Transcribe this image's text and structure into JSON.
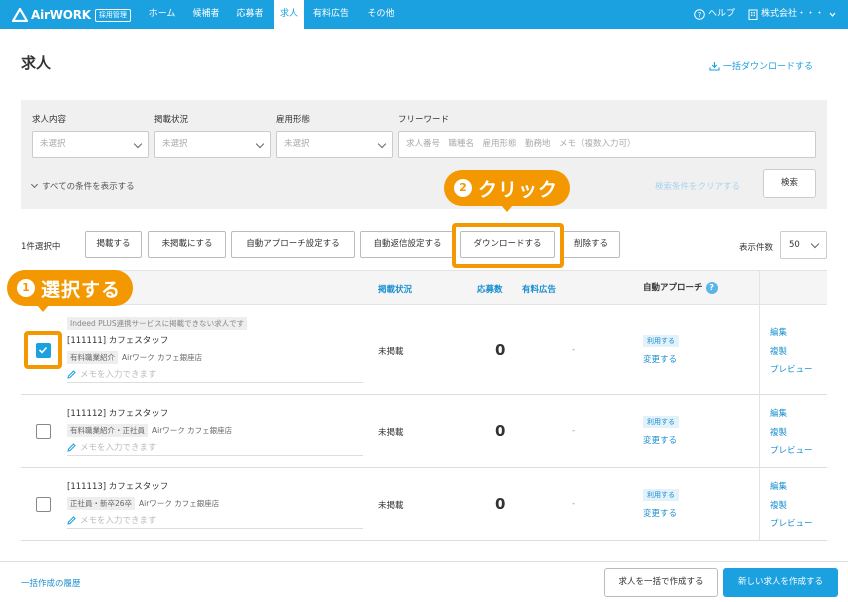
{
  "header": {
    "logo_text": "AirWORK",
    "logo_badge": "採用管理",
    "nav": [
      "ホーム",
      "候補者",
      "応募者",
      "求人",
      "有料広告",
      "その他"
    ],
    "active_nav": "求人",
    "help_label": "ヘルプ",
    "company_label": "株式会社・・・",
    "accent_color": "#1ba0e0"
  },
  "page": {
    "title": "求人",
    "bulk_download": "一括ダウンロードする"
  },
  "filters": {
    "job_content_label": "求人内容",
    "job_content_value": "未選択",
    "listing_status_label": "掲載状況",
    "listing_status_value": "未選択",
    "employment_label": "雇用形態",
    "employment_value": "未選択",
    "freeword_label": "フリーワード",
    "freeword_placeholder": "求人番号　職種名　雇用形態　勤務地　メモ（複数入力可）",
    "show_all": "すべての条件を表示する",
    "clear": "検索条件をクリアする",
    "search": "検索"
  },
  "actions": {
    "selected_count": "1件選択中",
    "publish": "掲載する",
    "unpublish": "未掲載にする",
    "auto_approach": "自動アプローチ設定する",
    "auto_reply": "自動返信設定する",
    "download": "ダウンロードする",
    "delete": "削除する",
    "per_page_label": "表示件数",
    "per_page_value": "50"
  },
  "callouts": {
    "step1_num": "1",
    "step1_text": "選択する",
    "step2_num": "2",
    "step2_text": "クリック",
    "color": "#f39800"
  },
  "table": {
    "headers": {
      "status": "掲載状況",
      "applications": "応募数",
      "paid_ads": "有料広告",
      "auto_approach": "自動アプローチ",
      "help": "?"
    },
    "rows": [
      {
        "notice": "Indeed PLUS連携サービスに掲載できない求人です",
        "title": "[111111] カフェスタッフ",
        "tags": [
          "有料職業紹介"
        ],
        "store": "Airワーク カフェ銀座店",
        "memo_placeholder": "メモを入力できます",
        "status": "未掲載",
        "applications": "0",
        "paid_ads": "-",
        "badge": "利用する",
        "change": "変更する",
        "links": [
          "編集",
          "複製",
          "プレビュー"
        ],
        "checked": true
      },
      {
        "notice": "",
        "title": "[111112] カフェスタッフ",
        "tags": [
          "有料職業紹介・正社員"
        ],
        "store": "Airワーク カフェ銀座店",
        "memo_placeholder": "メモを入力できます",
        "status": "未掲載",
        "applications": "0",
        "paid_ads": "-",
        "badge": "利用する",
        "change": "変更する",
        "links": [
          "編集",
          "複製",
          "プレビュー"
        ],
        "checked": false
      },
      {
        "notice": "",
        "title": "[111113] カフェスタッフ",
        "tags": [
          "正社員・新卒26卒"
        ],
        "store": "Airワーク カフェ銀座店",
        "memo_placeholder": "メモを入力できます",
        "status": "未掲載",
        "applications": "0",
        "paid_ads": "-",
        "badge": "利用する",
        "change": "変更する",
        "links": [
          "編集",
          "複製",
          "プレビュー"
        ],
        "checked": false
      }
    ]
  },
  "footer": {
    "history": "一括作成の履歴",
    "bulk_create": "求人を一括で作成する",
    "new_job": "新しい求人を作成する"
  }
}
